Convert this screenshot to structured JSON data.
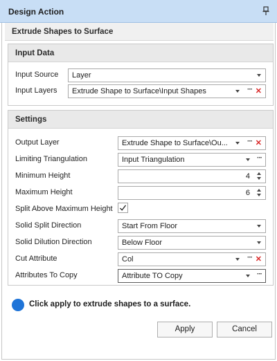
{
  "window": {
    "title": "Design Action",
    "pin_icon": "pin-icon"
  },
  "heading": "Extrude Shapes to Surface",
  "input_data": {
    "title": "Input Data",
    "input_source": {
      "label": "Input Source",
      "value": "Layer"
    },
    "input_layers": {
      "label": "Input Layers",
      "value": "Extrude Shape to Surface\\Input Shapes"
    }
  },
  "settings": {
    "title": "Settings",
    "output_layer": {
      "label": "Output Layer",
      "value": "Extrude Shape to Surface\\Ou..."
    },
    "limiting_triangulation": {
      "label": "Limiting Triangulation",
      "value": "Input Triangulation"
    },
    "minimum_height": {
      "label": "Minimum Height",
      "value": "4"
    },
    "maximum_height": {
      "label": "Maximum Height",
      "value": "6"
    },
    "split_above_max": {
      "label": "Split Above Maximum Height",
      "checked": true
    },
    "solid_split_direction": {
      "label": "Solid Split Direction",
      "value": "Start From Floor"
    },
    "solid_dilution_direction": {
      "label": "Solid Dilution Direction",
      "value": "Below Floor"
    },
    "cut_attribute": {
      "label": "Cut Attribute",
      "value": "Col"
    },
    "attributes_to_copy": {
      "label": "Attributes To Copy",
      "value": "Attribute TO Copy"
    }
  },
  "info": {
    "message": "Click apply to extrude shapes to a surface.",
    "icon": "info-dot-icon",
    "color": "#1f74d8"
  },
  "buttons": {
    "apply": "Apply",
    "cancel": "Cancel"
  },
  "colors": {
    "titlebar": "#c8def5",
    "clear_x": "#d92626"
  }
}
